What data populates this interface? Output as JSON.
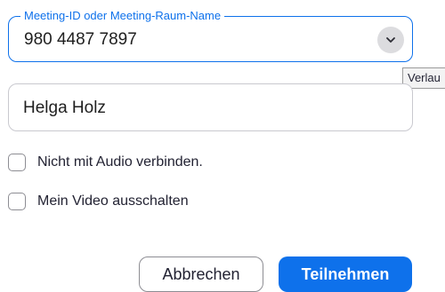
{
  "meeting": {
    "legend": "Meeting-ID oder Meeting-Raum-Name",
    "value": "980 4487 7897",
    "history_icon": "chevron-down-icon"
  },
  "tooltip": {
    "text": "Verlau"
  },
  "name": {
    "value": "Helga Holz"
  },
  "options": {
    "audio_label": "Nicht mit Audio verbinden.",
    "audio_checked": false,
    "video_label": "Mein Video ausschalten",
    "video_checked": false
  },
  "buttons": {
    "cancel_label": "Abbrechen",
    "join_label": "Teilnehmen"
  },
  "colors": {
    "accent": "#0e71eb",
    "text": "#232333",
    "border": "#c9c9cf"
  }
}
